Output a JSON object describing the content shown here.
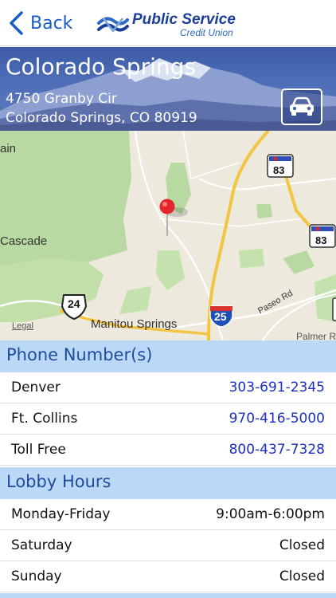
{
  "nav": {
    "back_label": "Back",
    "logo_name": "Public Service",
    "logo_sub": "Credit Union",
    "accent": "#1a5cc8"
  },
  "branch": {
    "city": "Colorado Springs",
    "address_line1": "4750 Granby Cir",
    "address_line2": "Colorado Springs, CO 80919",
    "directions_icon": "car-icon"
  },
  "map": {
    "labels": {
      "ain": "ain",
      "cascade": "Cascade",
      "manitou": "Manitou Springs",
      "legal": "Legal",
      "paseo": "Paseo Rd",
      "palmer": "Palmer R"
    },
    "shields": {
      "hwy83_top": "83",
      "hwy83_right": "83",
      "us24": "24",
      "i25": "25"
    },
    "pin_icon": "map-pin-icon"
  },
  "phone_section": {
    "title": "Phone Number(s)",
    "rows": [
      {
        "label": "Denver",
        "value": "303-691-2345"
      },
      {
        "label": "Ft. Collins",
        "value": "970-416-5000"
      },
      {
        "label": "Toll Free",
        "value": "800-437-7328"
      }
    ]
  },
  "hours_section": {
    "title": "Lobby Hours",
    "rows": [
      {
        "label": "Monday-Friday",
        "value": "9:00am-6:00pm"
      },
      {
        "label": "Saturday",
        "value": "Closed"
      },
      {
        "label": "Sunday",
        "value": "Closed"
      }
    ]
  },
  "colors": {
    "section_header_bg": "#bcd8f7",
    "section_header_text": "#1f4c9e",
    "link": "#1c2fc2",
    "brand_blue": "#1c3d9a"
  }
}
